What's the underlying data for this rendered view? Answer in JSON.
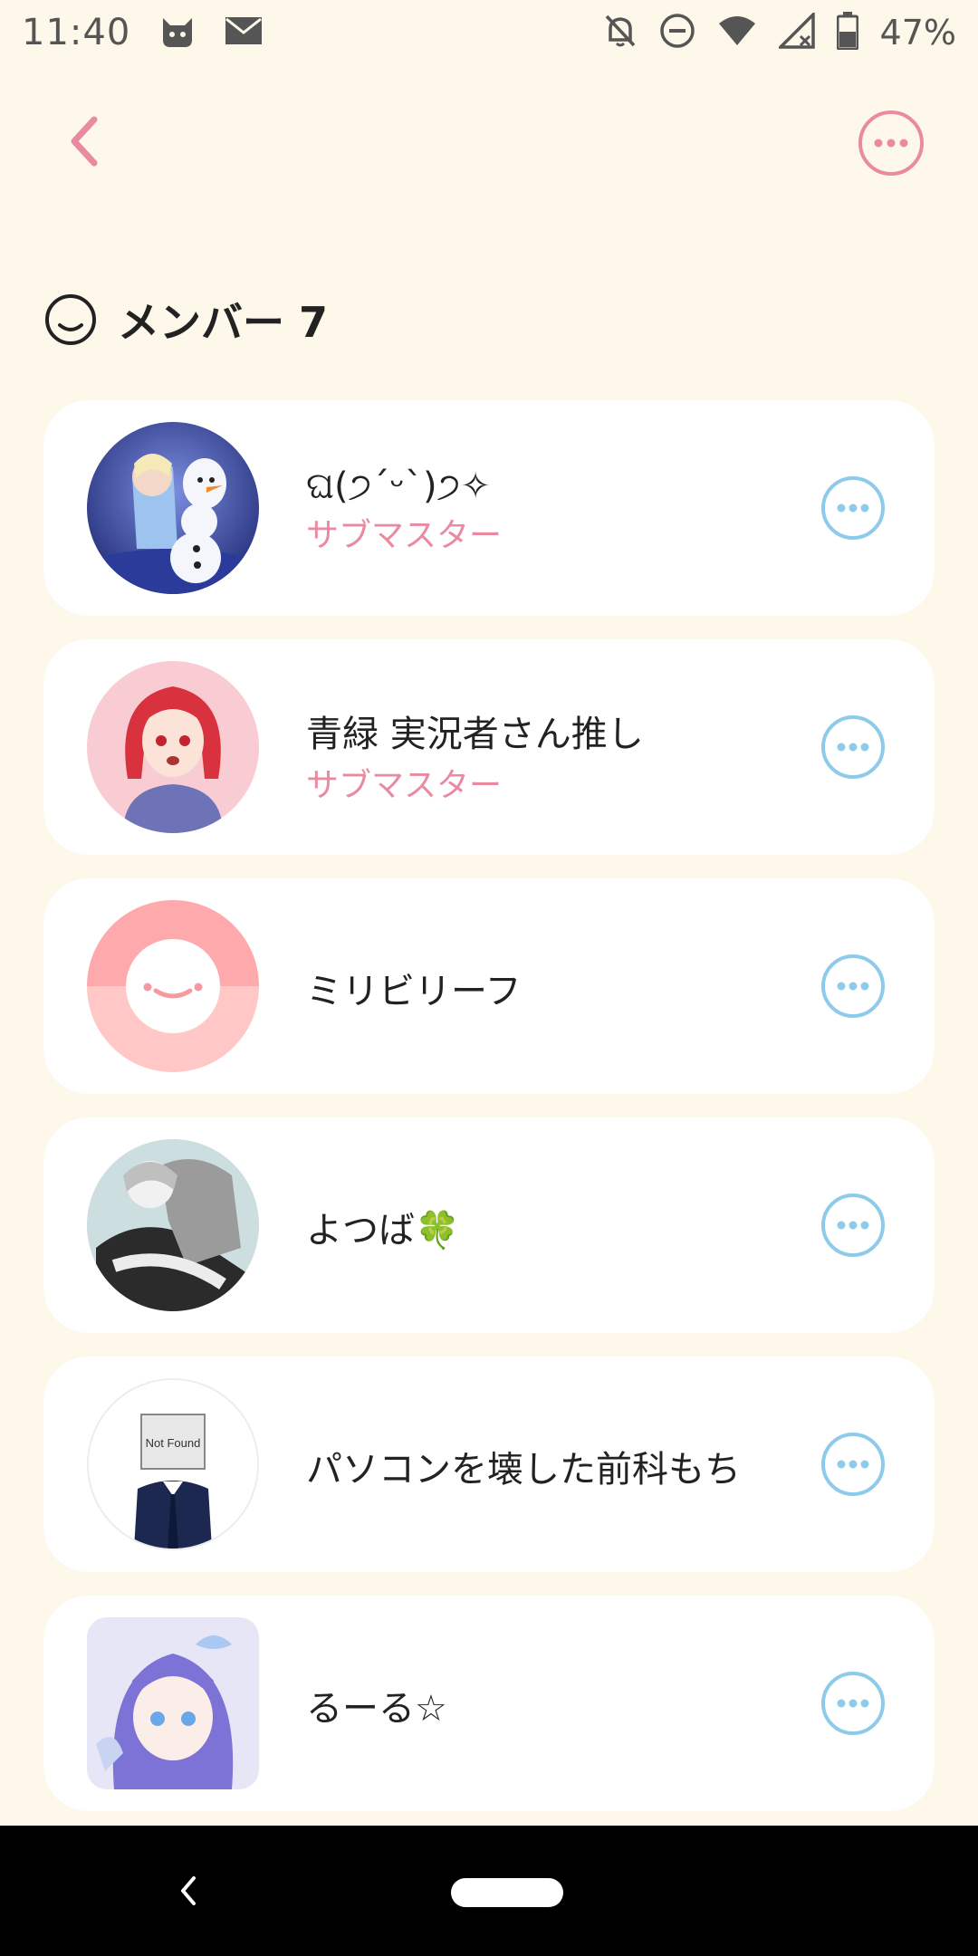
{
  "status_bar": {
    "time": "11:40",
    "battery": "47%",
    "icons": [
      "cat-icon",
      "mail-icon",
      "bell-off-icon",
      "do-not-disturb-icon",
      "wifi-icon",
      "signal-icon",
      "battery-icon"
    ]
  },
  "app_bar": {
    "back_icon": "chevron-left-icon",
    "more_icon": "more-horizontal-circle-icon"
  },
  "members": {
    "title": "メンバー 7",
    "items": [
      {
        "name": "ଘ(੭ˊᵕˋ)੭✧",
        "role": "サブマスター"
      },
      {
        "name": "青緑 実況者さん推し",
        "role": "サブマスター"
      },
      {
        "name": "ミリビリーフ",
        "role": ""
      },
      {
        "name": "よつば🍀",
        "role": ""
      },
      {
        "name": "パソコンを壊した前科もち",
        "role": "",
        "avatar_text": "Not Found"
      },
      {
        "name": "るーる☆",
        "role": ""
      }
    ]
  },
  "colors": {
    "background": "#fdf8ea",
    "accent_pink": "#e98aa0",
    "accent_blue": "#8ecbea",
    "card": "#ffffff"
  }
}
